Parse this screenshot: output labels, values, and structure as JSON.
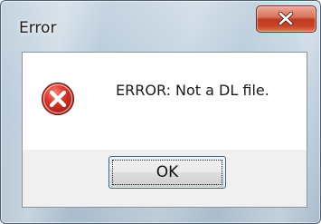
{
  "dialog": {
    "title": "Error",
    "message": "ERROR: Not a DL file.",
    "icon": "error-icon",
    "buttons": {
      "ok_label": "OK",
      "close_icon": "close-icon"
    }
  },
  "colors": {
    "close_button": "#c8452b",
    "error_icon": "#c0392b",
    "focus_border": "#2c628b"
  }
}
